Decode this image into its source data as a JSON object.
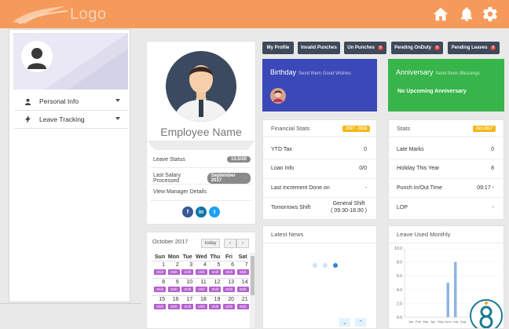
{
  "header": {
    "logo_text": "Logo",
    "icons": [
      "home-icon",
      "bell-icon",
      "gear-icon"
    ],
    "bg_color": "#f59a5a"
  },
  "sidebar": {
    "items": [
      {
        "label": "Personal Info",
        "icon": "person-icon"
      },
      {
        "label": "Leave Tracking",
        "icon": "bolt-icon"
      }
    ]
  },
  "profile": {
    "name": "Employee Name",
    "rows": [
      {
        "label": "Leave Status",
        "value": "13.5/20"
      },
      {
        "label": "Last Salary Processed",
        "value": "September 2017"
      },
      {
        "label": "View Manager Details",
        "value": ""
      }
    ],
    "social": [
      {
        "label": "f",
        "color": "#3b5998",
        "name": "facebook-icon"
      },
      {
        "label": "in",
        "color": "#0e76a8",
        "name": "linkedin-icon"
      },
      {
        "label": "t",
        "color": "#1da1f2",
        "name": "twitter-icon"
      }
    ]
  },
  "calendar": {
    "title": "October 2017",
    "today_label": "today",
    "prev": "‹",
    "next": "›",
    "weekdays": [
      "Sun",
      "Mon",
      "Tue",
      "Wed",
      "Thu",
      "Fri",
      "Sat"
    ],
    "weeks": [
      [
        "1",
        "2",
        "3",
        "4",
        "5",
        "6",
        "7"
      ],
      [
        "8",
        "9",
        "10",
        "11",
        "12",
        "13",
        "14"
      ],
      [
        "15",
        "16",
        "17",
        "18",
        "19",
        "20",
        "21"
      ]
    ],
    "shift_label": "Shift"
  },
  "toolbar": {
    "buttons": [
      {
        "label": "My Profile",
        "count": ""
      },
      {
        "label": "Invalid Punches",
        "count": ""
      },
      {
        "label": "Un Punches",
        "count": "0"
      },
      {
        "label": "Pending OnDuty",
        "count": "0"
      },
      {
        "label": "Pending Leaves",
        "count": "0"
      }
    ]
  },
  "birthday": {
    "title": "Birthday",
    "sub": "Send them Good Wishes"
  },
  "anniversary": {
    "title": "Anniversary",
    "sub": "Send them Blessings",
    "message": "No Upcoming Anniversary"
  },
  "financial": {
    "title": "Financial Stats",
    "badge": "2017 - 2018",
    "rows": [
      {
        "label": "YTD Tax",
        "value": "0"
      },
      {
        "label": "Loan Info",
        "value": "0/0"
      },
      {
        "label": "Last Increment Done on",
        "value": "-"
      },
      {
        "label": "Tomorrows Shift",
        "value": "General Shift\n( 09:30-18:30 )"
      }
    ]
  },
  "stats": {
    "title": "Stats",
    "badge": "Oct 2017",
    "rows": [
      {
        "label": "Late Marks",
        "value": "0"
      },
      {
        "label": "Holiday This Year",
        "value": "8"
      },
      {
        "label": "Punch In/Out Time",
        "value": "09:17 -"
      },
      {
        "label": "LOP",
        "value": "-"
      }
    ]
  },
  "news": {
    "title": "Latest News",
    "down": "⌄",
    "up": "⌃"
  },
  "leave_chart": {
    "title": "Leave Used Monthly",
    "chart_data": {
      "type": "bar",
      "categories": [
        "Jan",
        "Feb",
        "Mar",
        "Apr",
        "May",
        "June",
        "July",
        "Aug"
      ],
      "values": [
        0,
        0,
        0,
        0,
        0,
        5,
        8,
        0
      ],
      "ylim": [
        0,
        10
      ],
      "yticks": [
        "10.0",
        "8.0",
        "6.0",
        "4.0",
        "2.0",
        "0.0"
      ],
      "xlabel": "Jan Feb Mar Apr May June July Aug",
      "color": "#8fb4e6"
    }
  }
}
